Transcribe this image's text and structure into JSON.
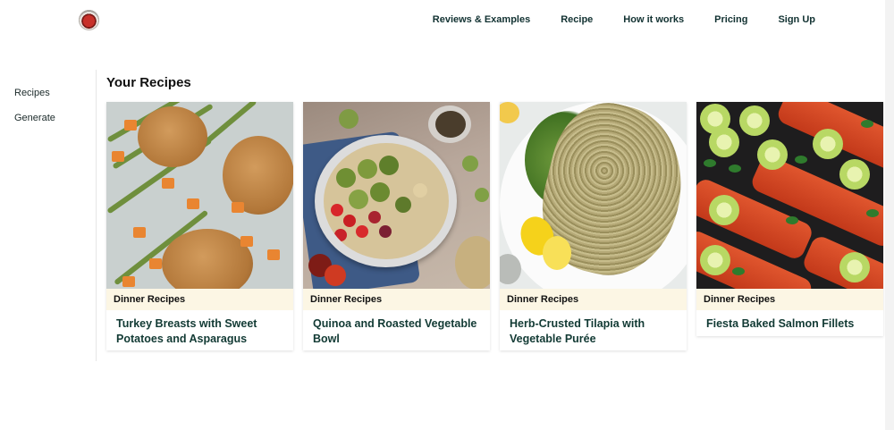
{
  "header": {
    "logo": "app-logo",
    "nav": [
      "Reviews & Examples",
      "Recipe",
      "How it works",
      "Pricing",
      "Sign Up"
    ]
  },
  "sidebar": {
    "items": [
      {
        "label": "Recipes"
      },
      {
        "label": "Generate"
      }
    ]
  },
  "main": {
    "title": "Your Recipes",
    "cards": [
      {
        "tag": "Dinner Recipes",
        "title": "Turkey Breasts with Sweet Potatoes and Asparagus"
      },
      {
        "tag": "Dinner Recipes",
        "title": "Quinoa and Roasted Vegetable Bowl"
      },
      {
        "tag": "Dinner Recipes",
        "title": "Herb-Crusted Tilapia with Vegetable Purée"
      },
      {
        "tag": "Dinner Recipes",
        "title": "Fiesta Baked Salmon Fillets"
      }
    ]
  },
  "colors": {
    "accent_text": "#123a34",
    "tag_background": "#fcf6e4"
  }
}
